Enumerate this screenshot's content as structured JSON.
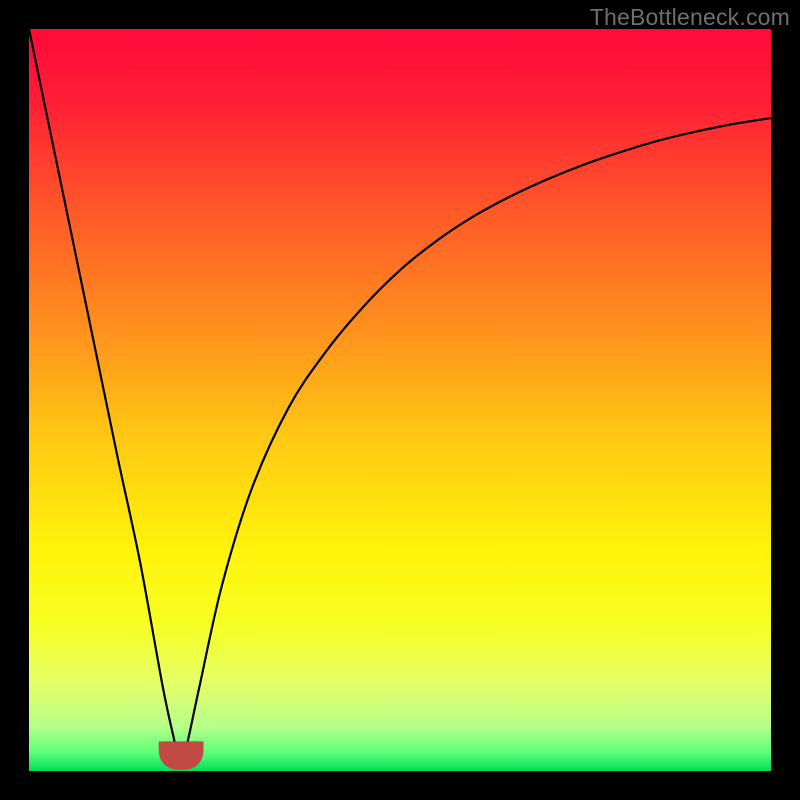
{
  "attribution": "TheBottleneck.com",
  "colors": {
    "frame": "#000000",
    "gradient_stops": [
      {
        "offset": 0.0,
        "color": "#ff0a3a"
      },
      {
        "offset": 0.1,
        "color": "#ff1f35"
      },
      {
        "offset": 0.25,
        "color": "#ff5a28"
      },
      {
        "offset": 0.4,
        "color": "#ff8f1e"
      },
      {
        "offset": 0.55,
        "color": "#ffc814"
      },
      {
        "offset": 0.7,
        "color": "#fff30a"
      },
      {
        "offset": 0.8,
        "color": "#f7ff22"
      },
      {
        "offset": 0.88,
        "color": "#e6ff66"
      },
      {
        "offset": 0.94,
        "color": "#b6ff8a"
      },
      {
        "offset": 0.975,
        "color": "#5cff7a"
      },
      {
        "offset": 1.0,
        "color": "#00e05a"
      }
    ],
    "curve": "#000000",
    "tick_fill": "#c24a45",
    "tick_stroke": "#8e2f2a"
  },
  "chart_data": {
    "type": "line",
    "title": "",
    "xlabel": "",
    "ylabel": "",
    "xlim": [
      0,
      1
    ],
    "ylim": [
      0,
      1
    ],
    "note": "Axis values are normalized (no tick labels visible in image). Curve shows a bottleneck-style dip reaching ~0 near x≈0.205, rising steeply on both sides.",
    "series": [
      {
        "name": "bottleneck-curve",
        "x": [
          0.0,
          0.03,
          0.06,
          0.09,
          0.12,
          0.15,
          0.18,
          0.195,
          0.205,
          0.215,
          0.23,
          0.26,
          0.3,
          0.35,
          0.4,
          0.45,
          0.5,
          0.55,
          0.6,
          0.65,
          0.7,
          0.75,
          0.8,
          0.85,
          0.9,
          0.95,
          1.0
        ],
        "y": [
          1.0,
          0.855,
          0.71,
          0.565,
          0.42,
          0.28,
          0.115,
          0.045,
          0.005,
          0.045,
          0.115,
          0.25,
          0.38,
          0.49,
          0.565,
          0.625,
          0.675,
          0.715,
          0.748,
          0.775,
          0.798,
          0.818,
          0.835,
          0.85,
          0.862,
          0.872,
          0.88
        ]
      }
    ],
    "marker": {
      "name": "optimum-tick",
      "shape": "u",
      "x": 0.205,
      "y": 0.012,
      "width_frac": 0.045,
      "height_frac": 0.028
    }
  }
}
